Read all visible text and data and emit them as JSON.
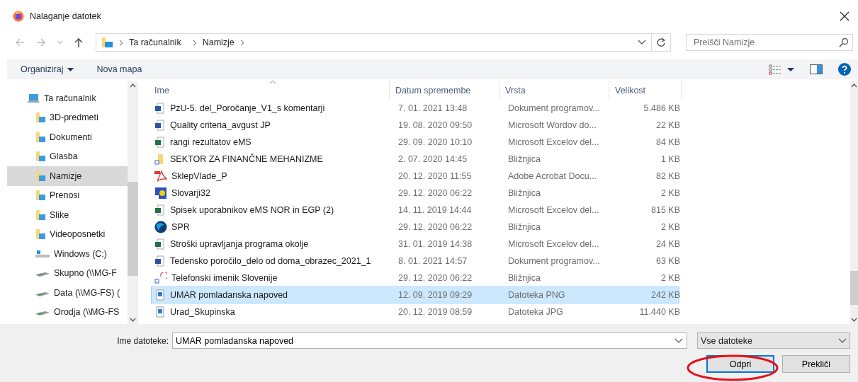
{
  "window": {
    "title": "Nalaganje datotek"
  },
  "navigation": {
    "breadcrumbs": [
      "Ta računalnik",
      "Namizje"
    ],
    "search": {
      "placeholder": "Preišči Namizje"
    }
  },
  "toolbar": {
    "buttons": [
      {
        "label": "Organiziraj",
        "dropdown": true
      },
      {
        "label": "Nova mapa",
        "dropdown": false
      }
    ]
  },
  "sidebar": {
    "items": [
      {
        "label": "Ta računalnik",
        "kind": "computer",
        "selected": false,
        "children": [
          {
            "label": "3D-predmeti",
            "kind": "folder",
            "selected": false
          },
          {
            "label": "Dokumenti",
            "kind": "folder",
            "selected": false
          },
          {
            "label": "Glasba",
            "kind": "folder",
            "selected": false
          },
          {
            "label": "Namizje",
            "kind": "folder",
            "selected": true
          },
          {
            "label": "Prenosi",
            "kind": "folder",
            "selected": false
          },
          {
            "label": "Slike",
            "kind": "folder",
            "selected": false
          },
          {
            "label": "Videoposnetki",
            "kind": "folder",
            "selected": false
          },
          {
            "label": "Windows (C:)",
            "kind": "drive",
            "selected": false
          },
          {
            "label": "Skupno (\\\\MG-F",
            "kind": "network",
            "selected": false
          },
          {
            "label": "Data (\\\\MG-FS) (",
            "kind": "network",
            "selected": false
          },
          {
            "label": "Orodja (\\\\MG-FS",
            "kind": "network",
            "selected": false
          }
        ]
      }
    ]
  },
  "file_list": {
    "columns": [
      {
        "label": "Ime",
        "sorted": true
      },
      {
        "label": "Datum spremembe",
        "sorted": false
      },
      {
        "label": "Vrsta",
        "sorted": false
      },
      {
        "label": "Velikost",
        "sorted": false
      }
    ],
    "rows": [
      {
        "name": "PzU-5. del_Poročanje_V1_s komentarji",
        "date": "7. 01. 2021 13:48",
        "type": "Dokument programov...",
        "size": "5.486 KB",
        "kind": "word",
        "selected": false
      },
      {
        "name": "Quality criteria_avgust JP",
        "date": "19. 08. 2020 09:50",
        "type": "Microsoft Wordov do...",
        "size": "22 KB",
        "kind": "word",
        "selected": false
      },
      {
        "name": "rangi rezultatov eMS",
        "date": "29. 09. 2020 10:10",
        "type": "Microsoft Excelov del...",
        "size": "84 KB",
        "kind": "excel",
        "selected": false
      },
      {
        "name": "SEKTOR ZA FINANČNE MEHANIZME",
        "date": "2. 07. 2020 14:45",
        "type": "Bližnjica",
        "size": "1 KB",
        "kind": "folder",
        "selected": false
      },
      {
        "name": "SklepVlade_P",
        "date": "20. 12. 2020 11:55",
        "type": "Adobe Acrobat Docu...",
        "size": "82 KB",
        "kind": "pdf",
        "selected": false
      },
      {
        "name": "Slovarji32",
        "date": "29. 12. 2020 06:22",
        "type": "Bližnjica",
        "size": "2 KB",
        "kind": "app",
        "selected": false
      },
      {
        "name": "Spisek uporabnikov eMS NOR in EGP (2)",
        "date": "14. 11. 2019 14:44",
        "type": "Microsoft Excelov del...",
        "size": "815 KB",
        "kind": "excel",
        "selected": false
      },
      {
        "name": "SPR",
        "date": "29. 12. 2020 06:22",
        "type": "Bližnjica",
        "size": "2 KB",
        "kind": "globe",
        "selected": false
      },
      {
        "name": "Stroški upravljanja programa okolje",
        "date": "31. 01. 2019 14:38",
        "type": "Microsoft Excelov del...",
        "size": "24 KB",
        "kind": "excel",
        "selected": false
      },
      {
        "name": "Tedensko poročilo_delo od doma_obrazec_2021_1",
        "date": "8. 01. 2021 14:57",
        "type": "Dokument programov...",
        "size": "63 KB",
        "kind": "word",
        "selected": false
      },
      {
        "name": "Telefonski imenik Slovenije",
        "date": "29. 12. 2020 06:22",
        "type": "Bližnjica",
        "size": "2 KB",
        "kind": "phone",
        "selected": false
      },
      {
        "name": "UMAR pomladanska napoved",
        "date": "12. 09. 2019 09:29",
        "type": "Datoteka PNG",
        "size": "242 KB",
        "kind": "image",
        "selected": true
      },
      {
        "name": "Urad_Skupinska",
        "date": "20. 12. 2019 08:59",
        "type": "Datoteka JPG",
        "size": "11.440 KB",
        "kind": "image",
        "selected": false
      }
    ]
  },
  "footer": {
    "filename_label": "Ime datoteke:",
    "filename_value": "UMAR pomladanska napoved",
    "filter": "Vse datoteke",
    "buttons": [
      {
        "label": "Odpri",
        "default": true
      },
      {
        "label": "Prekliči",
        "default": false
      }
    ]
  }
}
